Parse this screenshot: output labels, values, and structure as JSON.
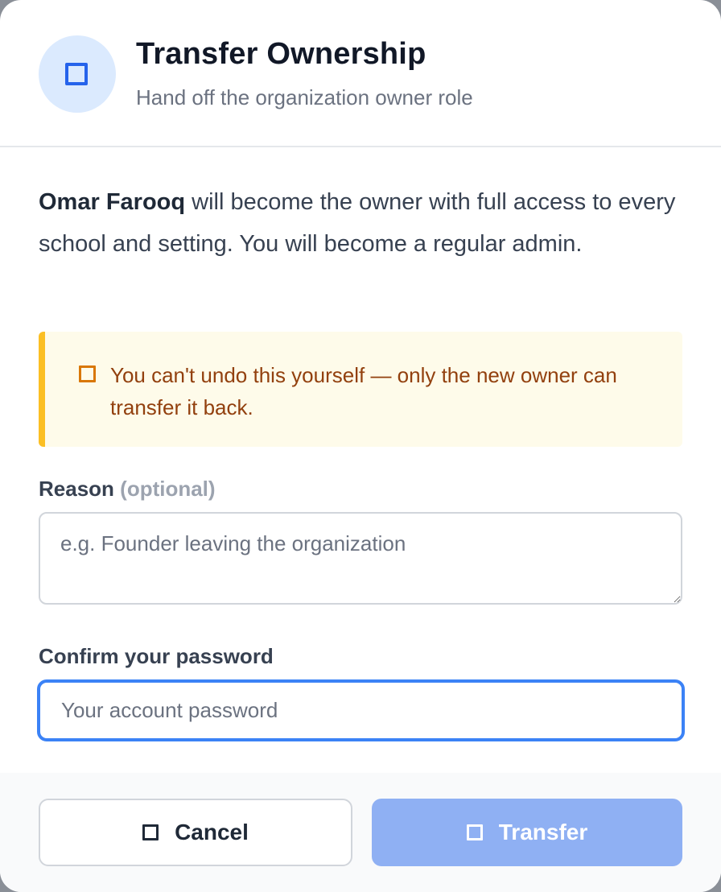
{
  "dialog": {
    "title": "Transfer Ownership",
    "subtitle": "Hand off the organization owner role",
    "header_icon": "transfer-icon"
  },
  "description": {
    "name": "Omar Farooq",
    "text": " will become the owner with full access to every school and setting. You will become a regular admin."
  },
  "warning": {
    "icon": "warning-icon",
    "text": "You can't undo this yourself — only the new owner can transfer it back."
  },
  "reason": {
    "label": "Reason",
    "optional": "(optional)",
    "placeholder": "e.g. Founder leaving the organization",
    "value": ""
  },
  "password": {
    "label": "Confirm your password",
    "placeholder": "Your account password",
    "value": ""
  },
  "buttons": {
    "cancel": "Cancel",
    "transfer": "Transfer"
  },
  "colors": {
    "accent": "#3b82f6",
    "icon_bg": "#dbeafe",
    "warning_bg": "#fefbea",
    "warning_border": "#fbbf24",
    "warning_text": "#92400e",
    "transfer_disabled": "#8fb0f3"
  }
}
